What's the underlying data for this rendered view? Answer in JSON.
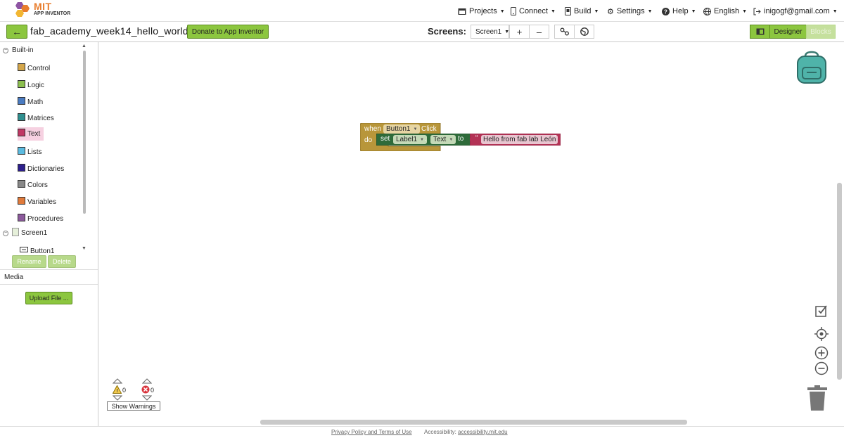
{
  "header": {
    "logo_title": "MIT",
    "logo_subtitle": "APP INVENTOR",
    "menu": [
      {
        "label": "Projects",
        "icon": "folder-icon"
      },
      {
        "label": "Connect",
        "icon": "phone-icon"
      },
      {
        "label": "Build",
        "icon": "build-icon"
      },
      {
        "label": "Settings",
        "icon": "gear-icon"
      },
      {
        "label": "Help",
        "icon": "help-icon"
      },
      {
        "label": "English",
        "icon": "globe-icon"
      },
      {
        "label": "inigogf@gmail.com",
        "icon": "logout-icon"
      }
    ]
  },
  "project": {
    "name": "fab_academy_week14_hello_world",
    "donate_label": "Donate to App Inventor",
    "screens_label": "Screens:",
    "current_screen": "Screen1",
    "add_screen": "+",
    "remove_screen": "–",
    "designer_label": "Designer",
    "blocks_label": "Blocks"
  },
  "blocks_panel": {
    "root_label": "Built-in",
    "categories": [
      {
        "label": "Control",
        "color": "#d4a64a"
      },
      {
        "label": "Logic",
        "color": "#8cbf4f"
      },
      {
        "label": "Math",
        "color": "#4a7bc1"
      },
      {
        "label": "Matrices",
        "color": "#2f8f8f"
      },
      {
        "label": "Text",
        "color": "#c03864"
      },
      {
        "label": "Lists",
        "color": "#5bbbe0"
      },
      {
        "label": "Dictionaries",
        "color": "#2d1f8c"
      },
      {
        "label": "Colors",
        "color": "#888888"
      },
      {
        "label": "Variables",
        "color": "#e07a3b"
      },
      {
        "label": "Procedures",
        "color": "#8c5a9c"
      }
    ],
    "screen_label": "Screen1",
    "component_label": "Button1",
    "rename_label": "Rename",
    "delete_label": "Delete",
    "media_label": "Media",
    "upload_label": "Upload File ..."
  },
  "workspace": {
    "event_block": {
      "when": "when",
      "component": "Button1",
      "event": "Click",
      "do": "do",
      "set": "set",
      "target_component": "Label1",
      "property": "Text",
      "to": "to",
      "text_value": "Hello from fab lab León",
      "colors": {
        "control": "#b8963a",
        "component": "#2e6b3a",
        "text": "#b33255"
      }
    },
    "warnings_count": "0",
    "errors_count": "0",
    "show_warnings_label": "Show Warnings"
  },
  "footer": {
    "privacy": "Privacy Policy and Terms of Use",
    "accessibility_label": "Accessibility:",
    "accessibility_link": "accessibility.mit.edu"
  }
}
